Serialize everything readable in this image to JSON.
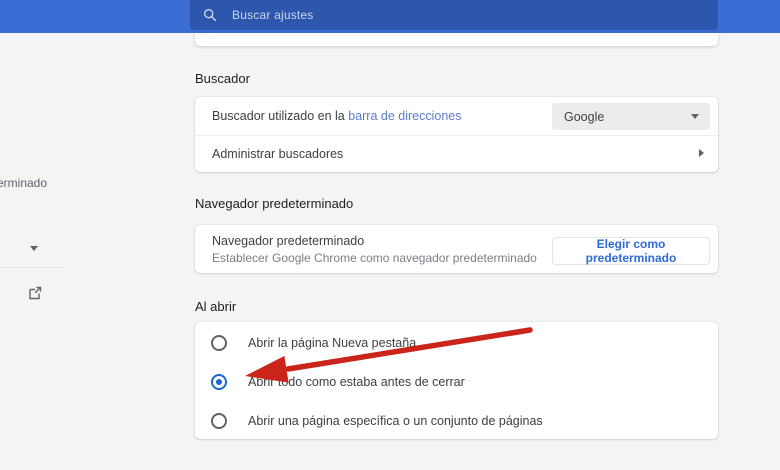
{
  "colors": {
    "header_bg": "#3b6cd4",
    "search_bg": "#2d56ad",
    "accent_blue": "#2e6bd3",
    "link_blue": "#5c7dca",
    "radio_blue": "#1a67d2",
    "arrow_red": "#cb241a",
    "dropdown_bg": "#ececec"
  },
  "header": {
    "search_placeholder": "Buscar ajustes"
  },
  "sidebar": {
    "partial_item_label": "erminado"
  },
  "sections": {
    "search_engine": {
      "title": "Buscador",
      "row1_prefix": "Buscador utilizado en la",
      "row1_link": "barra de direcciones",
      "dropdown_value": "Google",
      "row2_label": "Administrar buscadores"
    },
    "default_browser": {
      "title": "Navegador predeterminado",
      "card_title": "Navegador predeterminado",
      "card_subtitle": "Establecer Google Chrome como navegador predeterminado",
      "button_label": "Elegir como predeterminado"
    },
    "on_startup": {
      "title": "Al abrir",
      "options": [
        {
          "label": "Abrir la página Nueva pestaña",
          "selected": false
        },
        {
          "label": "Abrir todo como estaba antes de cerrar",
          "selected": true
        },
        {
          "label": "Abrir una página específica o un conjunto de páginas",
          "selected": false
        }
      ]
    }
  }
}
